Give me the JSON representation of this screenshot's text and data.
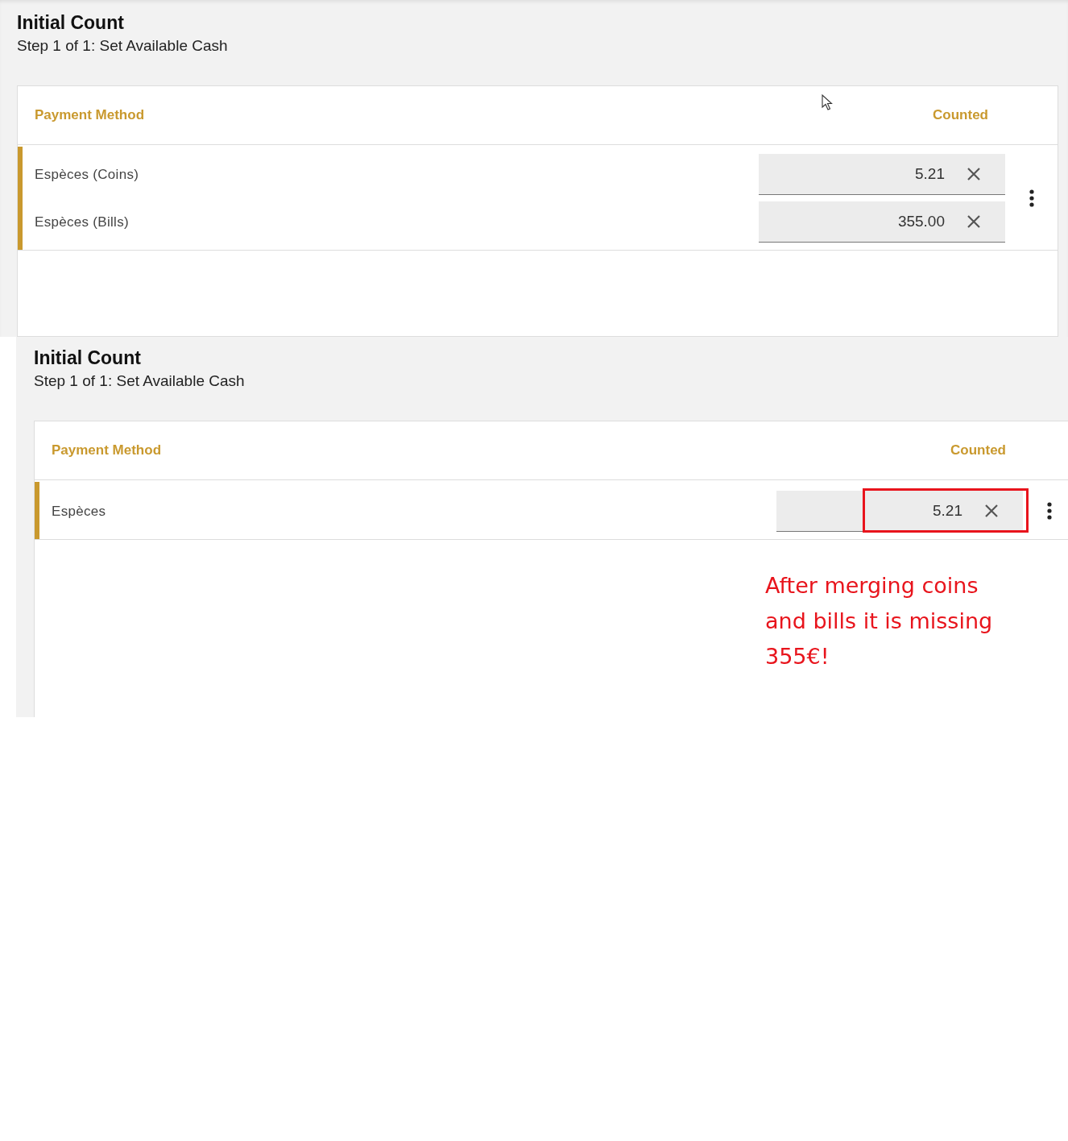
{
  "screenshots": [
    {
      "title": "Initial Count",
      "subtitle": "Step 1 of 1: Set Available Cash",
      "columns": [
        "Payment Method",
        "Counted"
      ],
      "cursor": true,
      "groups": [
        {
          "lines": [
            {
              "label": "Espèces (Coins)",
              "value": "5.21",
              "highlighted": false
            },
            {
              "label": "Espèces (Bills)",
              "value": "355.00",
              "highlighted": false
            }
          ]
        }
      ]
    },
    {
      "title": "Initial Count",
      "subtitle": "Step 1 of 1: Set Available Cash",
      "columns": [
        "Payment Method",
        "Counted"
      ],
      "cursor": false,
      "groups": [
        {
          "lines": [
            {
              "label": "Espèces",
              "value": "5.21",
              "highlighted": true
            }
          ]
        }
      ],
      "annotation": {
        "lines": [
          "After merging coins",
          "and bills it is missing",
          "355€!"
        ]
      }
    }
  ]
}
